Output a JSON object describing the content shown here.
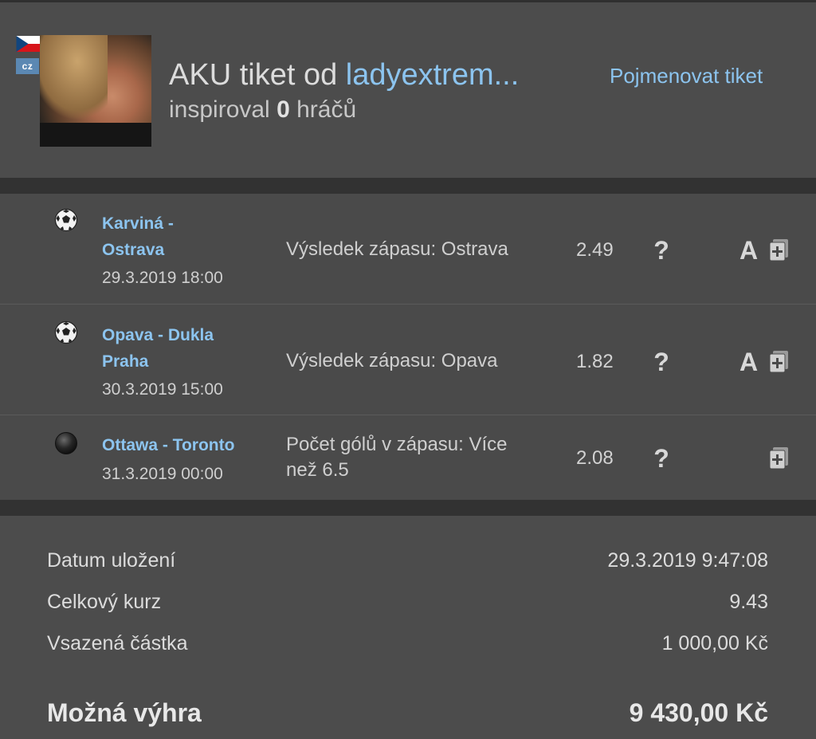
{
  "header": {
    "flag_alt": "Czech flag",
    "country_code": "cz",
    "title_prefix": "AKU tiket od ",
    "username": "ladyextrem...",
    "inspired_prefix": "inspiroval",
    "inspired_count": "0",
    "inspired_suffix": "hráčů",
    "rename_label": "Pojmenovat tiket"
  },
  "bets": [
    {
      "sport_icon": "soccer-ball-icon",
      "match_line1": "Karviná -",
      "match_line2": "Ostrava",
      "date": "29.3.2019 18:00",
      "bet_line1": "Výsledek zápasu: Ostrava",
      "bet_line2": "",
      "odds": "2.49",
      "status": "?",
      "a_label": "A"
    },
    {
      "sport_icon": "soccer-ball-icon",
      "match_line1": "Opava - Dukla",
      "match_line2": "Praha",
      "date": "30.3.2019 15:00",
      "bet_line1": "Výsledek zápasu: Opava",
      "bet_line2": "",
      "odds": "1.82",
      "status": "?",
      "a_label": "A"
    },
    {
      "sport_icon": "hockey-puck-icon",
      "match_line1": "Ottawa - Toronto",
      "match_line2": "",
      "date": "31.3.2019 00:00",
      "bet_line1": "Počet gólů v zápasu: Více",
      "bet_line2": "než 6.5",
      "odds": "2.08",
      "status": "?",
      "a_label": ""
    }
  ],
  "summary": {
    "saved_label": "Datum uložení",
    "saved_value": "29.3.2019 9:47:08",
    "total_odds_label": "Celkový kurz",
    "total_odds_value": "9.43",
    "stake_label": "Vsazená částka",
    "stake_value": "1 000,00 Kč",
    "win_label": "Možná výhra",
    "win_value": "9 430,00 Kč"
  },
  "colors": {
    "link": "#8cc4ef",
    "panel": "#4c4c4c",
    "separator": "#323232"
  }
}
